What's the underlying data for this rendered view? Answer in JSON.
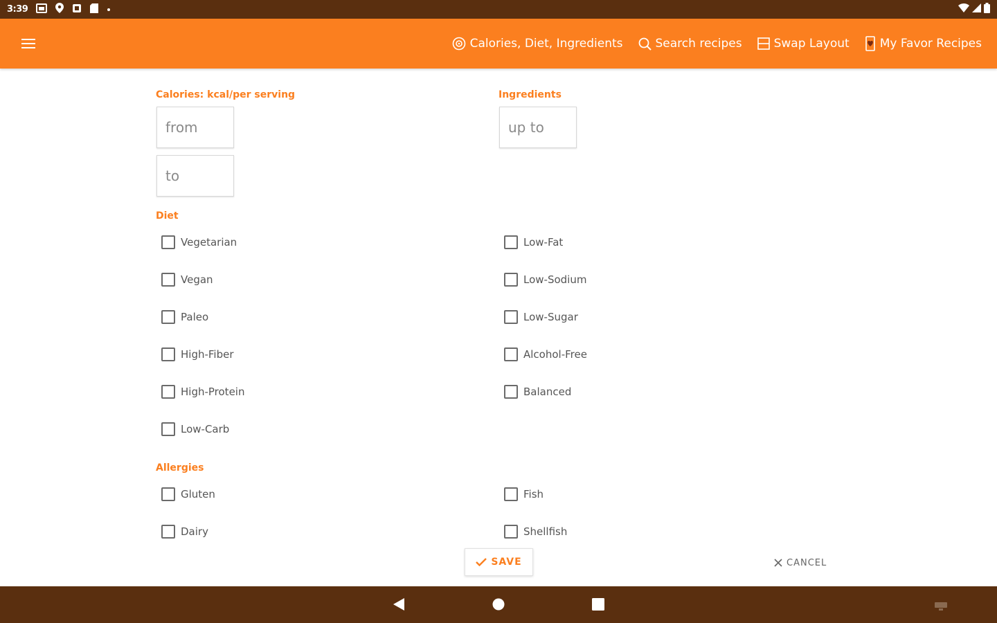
{
  "status_bar": {
    "time": "3:39"
  },
  "app_bar": {
    "actions": [
      {
        "label": "Calories, Diet, Ingredients",
        "icon": "target-icon"
      },
      {
        "label": "Search recipes",
        "icon": "search-icon"
      },
      {
        "label": "Swap Layout",
        "icon": "swap-layout-icon"
      },
      {
        "label": "My Favor Recipes",
        "icon": "favorite-icon"
      }
    ]
  },
  "calories": {
    "label": "Calories: kcal/per serving",
    "from_placeholder": "from",
    "to_placeholder": "to"
  },
  "ingredients": {
    "label": "Ingredients",
    "placeholder": "up to"
  },
  "diet": {
    "label": "Diet",
    "left": [
      "Vegetarian",
      "Vegan",
      "Paleo",
      "High-Fiber",
      "High-Protein",
      "Low-Carb"
    ],
    "right": [
      "Low-Fat",
      "Low-Sodium",
      "Low-Sugar",
      "Alcohol-Free",
      "Balanced"
    ]
  },
  "allergies": {
    "label": "Allergies",
    "left": [
      "Gluten",
      "Dairy"
    ],
    "right": [
      "Fish",
      "Shellfish"
    ]
  },
  "buttons": {
    "save": "SAVE",
    "cancel": "CANCEL"
  },
  "colors": {
    "accent": "#fb7f1f",
    "system_bar": "#5a2f0f"
  }
}
